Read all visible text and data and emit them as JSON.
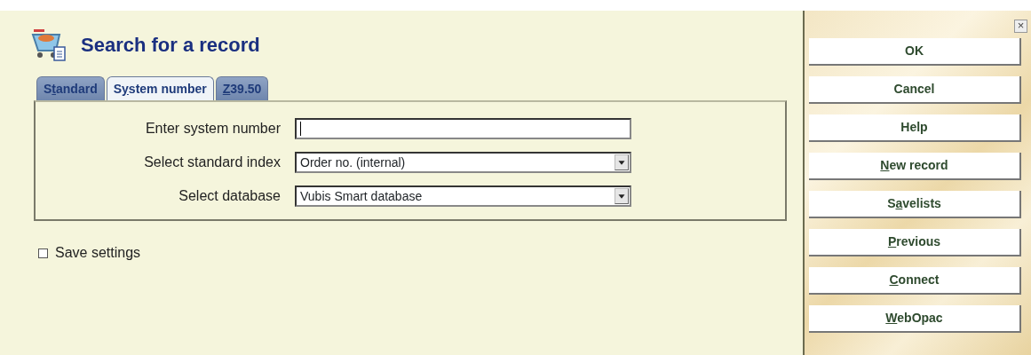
{
  "title": "Search for a record",
  "tabs": [
    {
      "label": {
        "before": "S",
        "key": "t",
        "after": "andard"
      },
      "selected": false
    },
    {
      "label": {
        "before": "S",
        "key": "y",
        "after": "stem number"
      },
      "selected": true
    },
    {
      "label": {
        "key": "Z",
        "after": "39.50"
      },
      "selected": false
    }
  ],
  "fields": [
    {
      "kind": "text",
      "label": "Enter system number"
    },
    {
      "kind": "select",
      "label": "Select standard index",
      "value": "Order no. (internal)"
    },
    {
      "kind": "select",
      "label": "Select database",
      "value": "Vubis Smart database"
    }
  ],
  "save_settings": {
    "label": "Save settings",
    "checked": false
  },
  "close_label": "×",
  "buttons": [
    {
      "label": {
        "before": "OK"
      }
    },
    {
      "label": {
        "before": "Cancel"
      }
    },
    {
      "label": {
        "before": "Help"
      }
    },
    {
      "label": {
        "key": "N",
        "after": "ew record"
      }
    },
    {
      "label": {
        "before": "S",
        "key": "a",
        "after": "velists"
      }
    },
    {
      "label": {
        "key": "P",
        "after": "revious"
      }
    },
    {
      "label": {
        "key": "C",
        "after": "onnect"
      }
    },
    {
      "label": {
        "key": "W",
        "after": "ebOpac"
      }
    }
  ]
}
